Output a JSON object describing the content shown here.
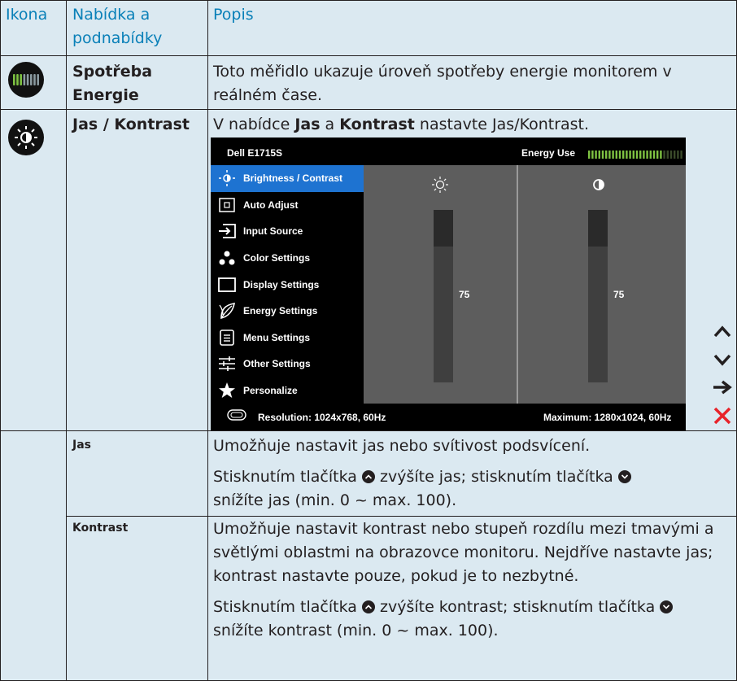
{
  "table": {
    "headers": {
      "icon": "Ikona",
      "menu": "Nabídka a podnabídky",
      "desc": "Popis"
    },
    "rows": {
      "energy": {
        "menu": "Spotřeba Energie",
        "desc": "Toto měřidlo ukazuje úroveň spotřeby energie monitorem v reálném čase."
      },
      "brightness": {
        "menu": "Jas / Kontrast",
        "desc_pre": "V nabídce ",
        "desc_b1": "Jas",
        "desc_mid": " a ",
        "desc_b2": "Kontrast",
        "desc_post": " nastavte Jas/Kontrast."
      },
      "jas": {
        "menu": "Jas",
        "desc1": "Umožňuje nastavit jas nebo svítivost podsvícení.",
        "desc2_a": "Stisknutím tlačítka ",
        "desc2_b": " zvýšíte jas; stisknutím tlačítka ",
        "desc2_c": "snížíte jas (min. 0 ~ max. 100)."
      },
      "kontrast": {
        "menu": "Kontrast",
        "desc1": "Umožňuje nastavit kontrast nebo stupeň rozdílu mezi tmavými a světlými oblastmi na obrazovce monitoru. Nejdříve nastavte jas; kontrast nastavte pouze, pokud je to nezbytné.",
        "desc2_a": "Stisknutím tlačítka ",
        "desc2_b": " zvýšíte kontrast; stisknutím tlačítka ",
        "desc2_c": "snížíte kontrast (min. 0 ~ max. 100)."
      }
    }
  },
  "osd": {
    "model": "Dell E1715S",
    "energy_label": "Energy Use",
    "energy_level": 0.8,
    "menu_items": [
      {
        "label": "Brightness / Contrast",
        "icon": "brightness-icon",
        "selected": true
      },
      {
        "label": "Auto Adjust",
        "icon": "auto-adjust-icon",
        "selected": false
      },
      {
        "label": "Input Source",
        "icon": "input-source-icon",
        "selected": false
      },
      {
        "label": "Color Settings",
        "icon": "color-settings-icon",
        "selected": false
      },
      {
        "label": "Display Settings",
        "icon": "display-settings-icon",
        "selected": false
      },
      {
        "label": "Energy Settings",
        "icon": "energy-settings-icon",
        "selected": false
      },
      {
        "label": "Menu Settings",
        "icon": "menu-settings-icon",
        "selected": false
      },
      {
        "label": "Other Settings",
        "icon": "other-settings-icon",
        "selected": false
      },
      {
        "label": "Personalize",
        "icon": "personalize-icon",
        "selected": false
      }
    ],
    "brightness_value": "75",
    "contrast_value": "75",
    "resolution": "Resolution: 1024x768, 60Hz",
    "maximum": "Maximum: 1280x1024, 60Hz"
  },
  "nav_buttons": [
    {
      "icon": "up-arrow-icon",
      "color": "#231f20"
    },
    {
      "icon": "down-arrow-icon",
      "color": "#231f20"
    },
    {
      "icon": "right-arrow-icon",
      "color": "#231f20"
    },
    {
      "icon": "close-icon",
      "color": "#e8232a"
    }
  ],
  "colors": {
    "header_text": "#0a80b8",
    "cell_bg": "#dbe9f1",
    "osd_selected": "#1e73d1"
  }
}
